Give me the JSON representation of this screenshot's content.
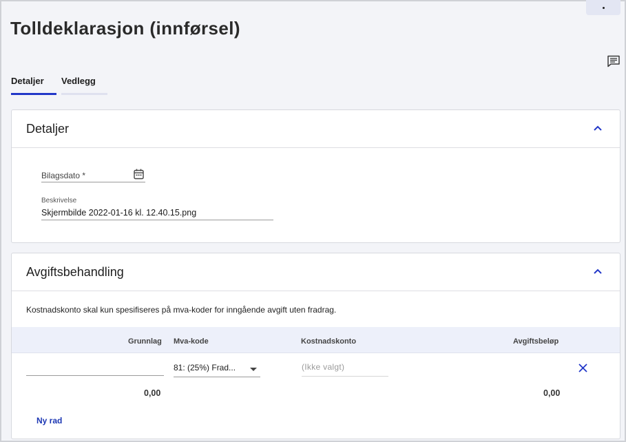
{
  "page": {
    "title": "Tolldeklarasjon (innførsel)"
  },
  "tabs": [
    {
      "label": "Detaljer"
    },
    {
      "label": "Vedlegg"
    }
  ],
  "details_card": {
    "title": "Detaljer",
    "date_field": {
      "label": "Bilagsdato *",
      "value": ""
    },
    "description_field": {
      "label": "Beskrivelse",
      "value": "Skjermbilde 2022-01-16 kl. 12.40.15.png"
    }
  },
  "fees_card": {
    "title": "Avgiftsbehandling",
    "info": "Kostnadskonto skal kun spesifiseres på mva-koder for inngående avgift uten fradrag.",
    "columns": {
      "grunnlag": "Grunnlag",
      "mva_kode": "Mva-kode",
      "kostnadskonto": "Kostnadskonto",
      "avgiftsbelop": "Avgiftsbeløp"
    },
    "row": {
      "grunnlag_value": "",
      "mva_kode_value": "81: (25%) Frad...",
      "kostnadskonto_placeholder": "(Ikke valgt)",
      "grunnlag_total": "0,00",
      "avgift_total": "0,00"
    },
    "new_row_label": "Ny rad"
  },
  "colors": {
    "accent": "#2237c8",
    "link": "#1c37b3",
    "tab_inactive": "#dfe1ef",
    "table_header_bg": "#edf0fa"
  },
  "icons": [
    "more-vertical-icon",
    "comment-icon",
    "chevron-up-icon",
    "calendar-icon",
    "dropdown-arrow-icon",
    "close-icon"
  ]
}
